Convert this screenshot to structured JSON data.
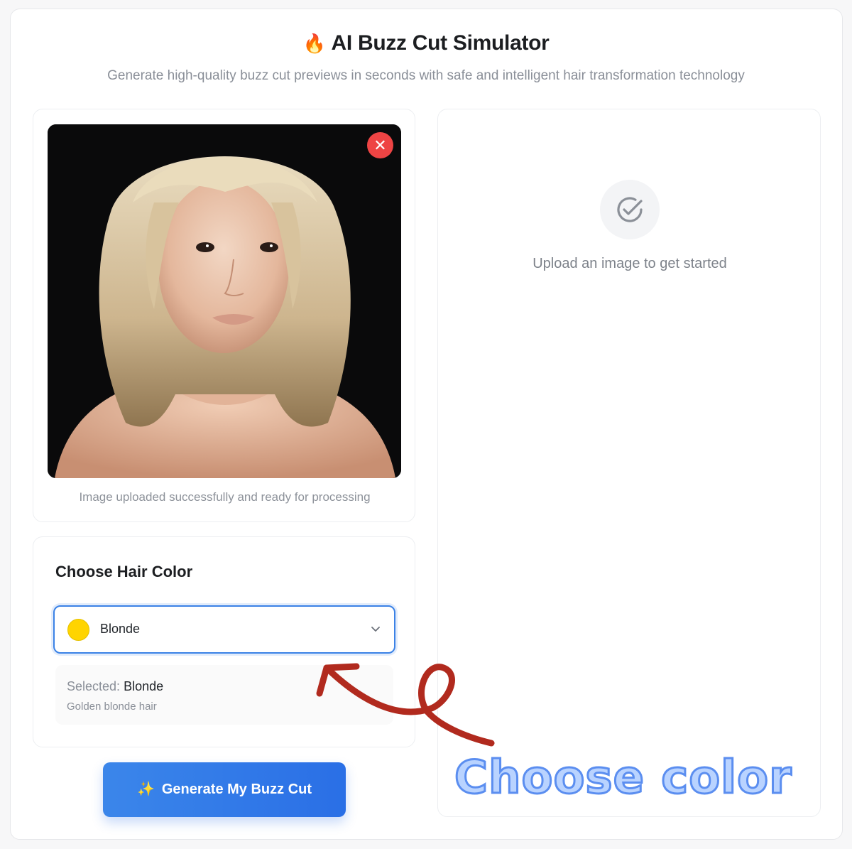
{
  "header": {
    "title": "AI Buzz Cut Simulator",
    "title_icon": "fire-emoji",
    "subtitle": "Generate high-quality buzz cut previews in seconds with safe and intelligent hair transformation technology"
  },
  "upload": {
    "image_alt": "Portrait of a woman with tousled blonde hair",
    "remove_label": "✕",
    "status": "Image uploaded successfully and ready for processing"
  },
  "result": {
    "icon": "check-circle-icon",
    "empty_text": "Upload an image to get started"
  },
  "hair_color": {
    "title": "Choose Hair Color",
    "selected_option": "Blonde",
    "swatch_color": "#ffd400",
    "selected_prefix": "Selected:",
    "selected_value": "Blonde",
    "description": "Golden blonde hair"
  },
  "actions": {
    "generate_label": "Generate My Buzz Cut",
    "generate_icon": "sparkles-icon"
  },
  "annotation": {
    "text": "Choose color",
    "arrow_color": "#b12a1e"
  },
  "colors": {
    "accent": "#2f78e8",
    "danger": "#ee4444"
  }
}
